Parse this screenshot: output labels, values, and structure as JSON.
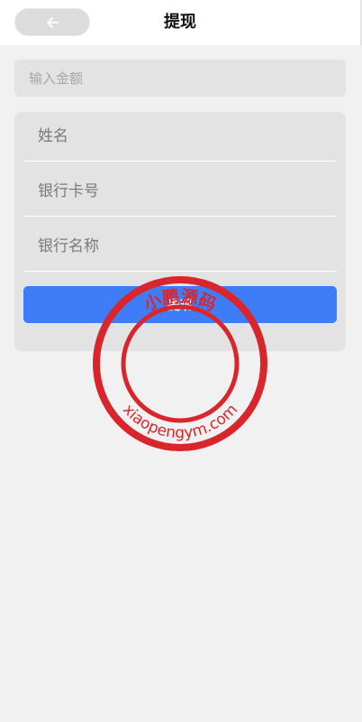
{
  "header": {
    "title": "提现",
    "back_icon": "arrow-left-icon"
  },
  "amount": {
    "placeholder": "输入金额",
    "value": ""
  },
  "form": {
    "name_placeholder": "姓名",
    "card_number_placeholder": "银行卡号",
    "bank_name_placeholder": "银行名称",
    "submit_label": "提现"
  },
  "watermark": {
    "top_text": "小鹏源码",
    "bottom_text": "xiaopengym.com",
    "color": "#d9262c"
  },
  "colors": {
    "accent": "#3f7cf7",
    "background": "#f1f1f2",
    "field_background": "#e3e3e3"
  }
}
